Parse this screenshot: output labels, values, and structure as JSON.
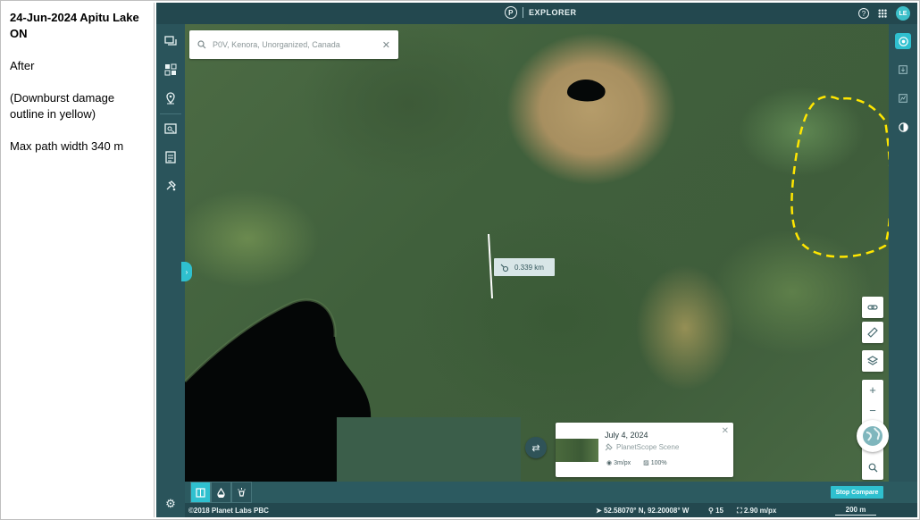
{
  "notes": {
    "title": "24-Jun-2024 Apitu Lake ON",
    "line1": "After",
    "line2": "(Downburst damage outline in yellow)",
    "line3": "Max path width 340 m"
  },
  "app": {
    "brand": "EXPLORER",
    "logo_letter": "P",
    "avatar_initials": "LE",
    "help_glyph": "?"
  },
  "search": {
    "placeholder": "P0V, Kenora, Unorganized, Canada",
    "clear": "✕"
  },
  "measurement": {
    "label": "0.339 km",
    "value_km": 0.339
  },
  "map_controls": {
    "zoom_in": "+",
    "zoom_out": "−"
  },
  "scene": {
    "date": "July 4, 2024",
    "type": "PlanetScope Scene",
    "resolution": "3m/px",
    "coverage": "100%",
    "close": "✕"
  },
  "compare": {
    "stop_label": "Stop Compare",
    "swap_glyph": "⇄"
  },
  "status": {
    "copyright": "©2018 Planet Labs PBC",
    "coordinates": "52.58070° N, 92.20008° W",
    "zoom": "15",
    "resolution": "2.90 m/px",
    "scale": "200 m"
  },
  "colors": {
    "accent": "#2fc0cf",
    "chrome": "#23484f",
    "outline": "#ffe600"
  }
}
